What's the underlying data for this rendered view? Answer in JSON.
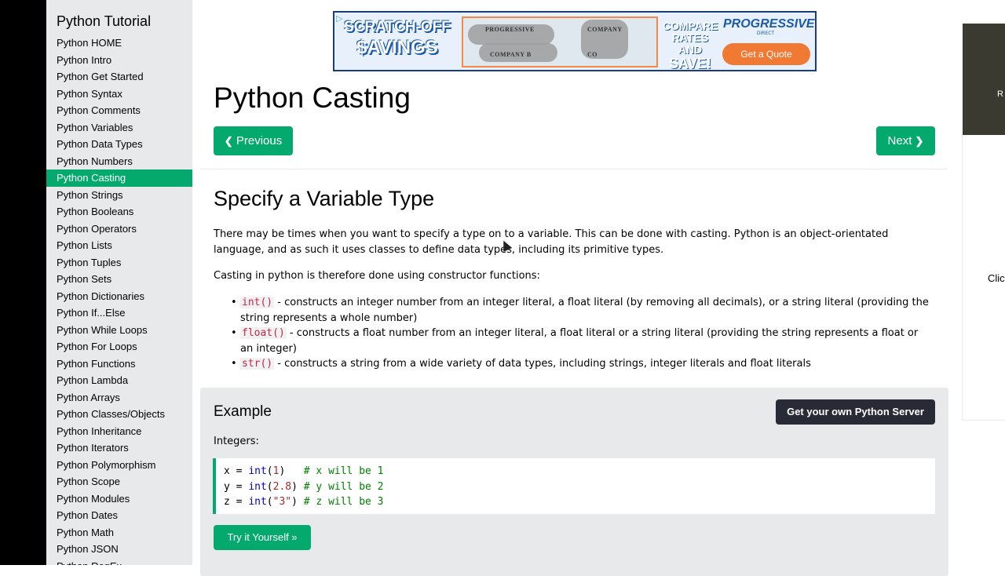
{
  "sidebar": {
    "title": "Python Tutorial",
    "items": [
      {
        "label": "Python HOME"
      },
      {
        "label": "Python Intro"
      },
      {
        "label": "Python Get Started"
      },
      {
        "label": "Python Syntax"
      },
      {
        "label": "Python Comments"
      },
      {
        "label": "Python Variables"
      },
      {
        "label": "Python Data Types"
      },
      {
        "label": "Python Numbers"
      },
      {
        "label": "Python Casting",
        "active": true
      },
      {
        "label": "Python Strings"
      },
      {
        "label": "Python Booleans"
      },
      {
        "label": "Python Operators"
      },
      {
        "label": "Python Lists"
      },
      {
        "label": "Python Tuples"
      },
      {
        "label": "Python Sets"
      },
      {
        "label": "Python Dictionaries"
      },
      {
        "label": "Python If...Else"
      },
      {
        "label": "Python While Loops"
      },
      {
        "label": "Python For Loops"
      },
      {
        "label": "Python Functions"
      },
      {
        "label": "Python Lambda"
      },
      {
        "label": "Python Arrays"
      },
      {
        "label": "Python Classes/Objects"
      },
      {
        "label": "Python Inheritance"
      },
      {
        "label": "Python Iterators"
      },
      {
        "label": "Python Polymorphism"
      },
      {
        "label": "Python Scope"
      },
      {
        "label": "Python Modules"
      },
      {
        "label": "Python Dates"
      },
      {
        "label": "Python Math"
      },
      {
        "label": "Python JSON"
      },
      {
        "label": "Python RegEx"
      }
    ]
  },
  "ad": {
    "scratch_line1": "SCRATCH-OFF",
    "scratch_line2": "$AVINGS",
    "company_a": "PROGRESSIVE",
    "company_b": "COMPANY B",
    "company_c": "COMPANY",
    "company_d": "CO",
    "rates_line1": "COMPARE",
    "rates_line2": "RATES AND",
    "rates_line3": "SAVE!",
    "brand": "PROGRESSIVE",
    "brand_sub": "DIRECT",
    "cta": "Get a Quote"
  },
  "page": {
    "title": "Python Casting",
    "prev_label": "Previous",
    "next_label": "Next",
    "section_title": "Specify a Variable Type",
    "para1": "There may be times when you want to specify a type on to a variable. This can be done with casting. Python is an object-orientated language, and as such it uses classes to define data types, including its primitive types.",
    "para2": "Casting in python is therefore done using constructor functions:",
    "list": [
      {
        "code": "int()",
        "text": " - constructs an integer number from an integer literal, a float literal (by removing all decimals), or a string literal (providing the string represents a whole number)"
      },
      {
        "code": "float()",
        "text": " - constructs a float number from an integer literal, a float literal or a string literal (providing the string represents a float or an integer)"
      },
      {
        "code": "str()",
        "text": " - constructs a string from a wide variety of data types, including strings, integer literals and float literals"
      }
    ]
  },
  "example": {
    "title": "Example",
    "server_button": "Get your own Python Server",
    "label": "Integers:",
    "code": [
      {
        "var": "x = ",
        "fn": "int",
        "open": "(",
        "arg": "1",
        "close": ")",
        "pad": "   ",
        "comment": "# x will be 1"
      },
      {
        "var": "y = ",
        "fn": "int",
        "open": "(",
        "arg": "2.8",
        "close": ")",
        "pad": " ",
        "comment": "# y will be 2"
      },
      {
        "var": "z = ",
        "fn": "int",
        "open": "(",
        "arg": "\"3\"",
        "close": ")",
        "pad": " ",
        "comment": "# z will be 3"
      }
    ],
    "try_button": "Try it Yourself »"
  },
  "right": {
    "ad_text": "R",
    "click_text": "Clic"
  },
  "colors": {
    "accent": "#04aa6d",
    "sidebar_bg": "#e7e9eb",
    "dark_button": "#282a35"
  },
  "icons": {
    "prev": "chevron-left-icon",
    "next": "chevron-right-icon",
    "ad_choices": "ad-choices-icon"
  }
}
